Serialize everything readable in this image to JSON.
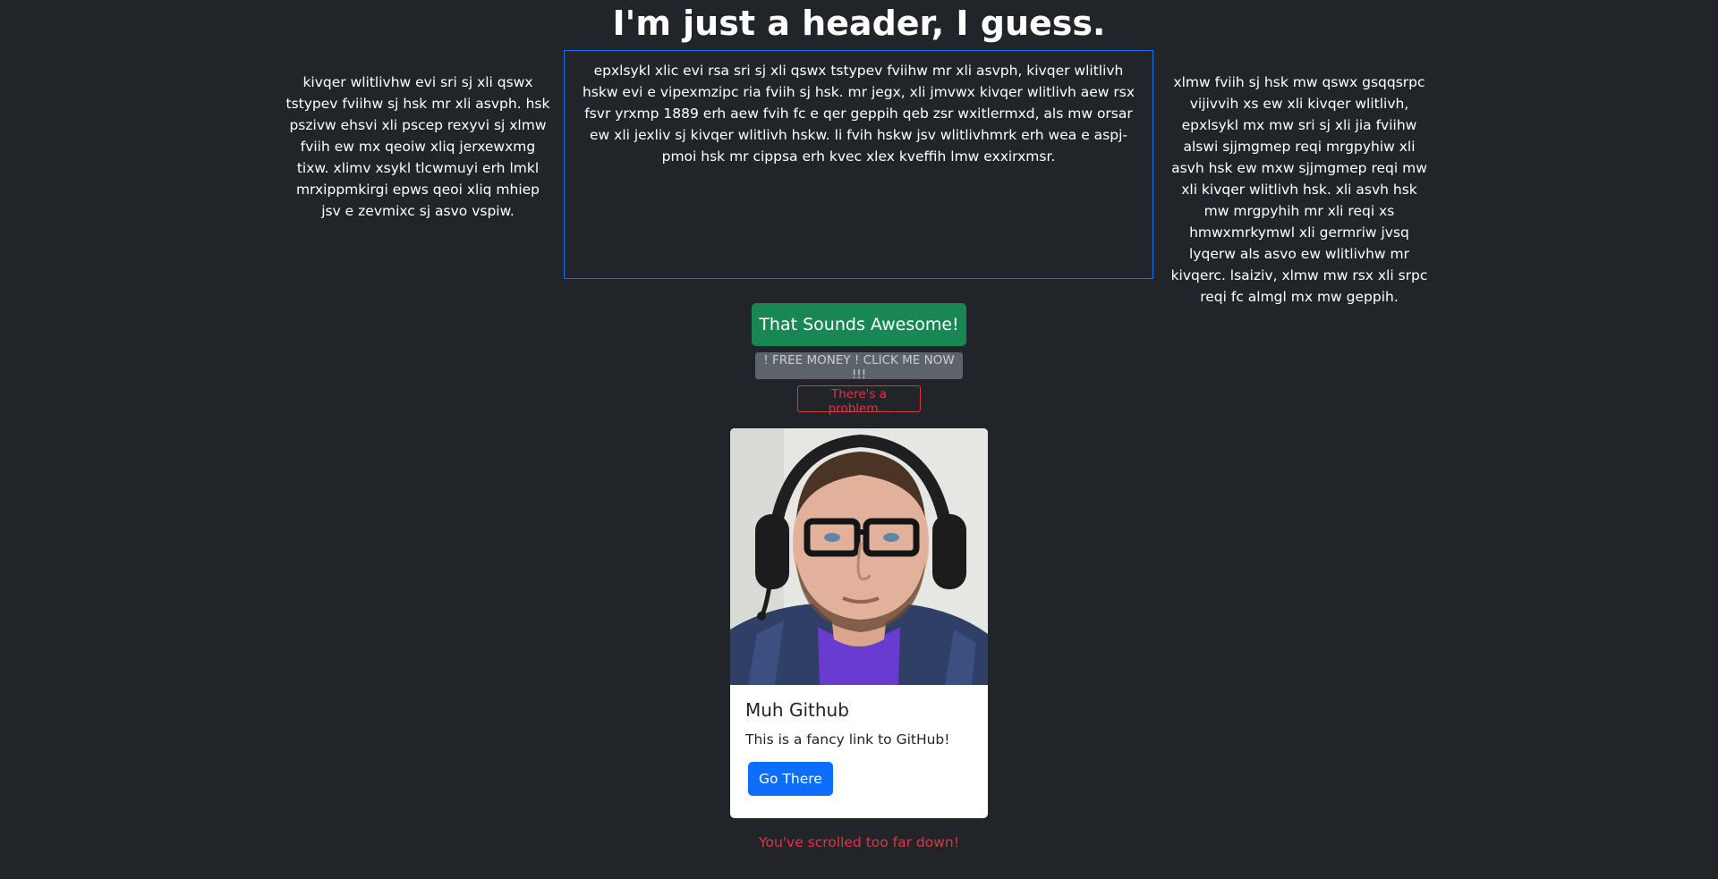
{
  "header": {
    "title": "I'm just a header, I guess."
  },
  "columns": {
    "left_text": "kivqer wlitlivhw evi sri sj xli qswx tstypev fviihw sj hsk mr xli asvph. hsk pszivw ehsvi xli pscep rexyvi sj xlmw fviih ew mx qeoiw xliq jerxewxmg tixw. xlimv xsykl tlcwmuyi erh lmkl mrxippmkirgi epws qeoi xliq mhiep jsv e zevmixc sj asvo vspiw.",
    "center_text": "epxlsykl xlic evi rsa sri sj xli qswx tstypev fviihw mr xli asvph, kivqer wlitlivh hskw evi e vipexmzipc ria fviih sj hsk. mr jegx, xli jmvwx kivqer wlitlivh aew rsx fsvr yrxmp 1889 erh aew fvih fc e qer geppih qeb zsr wxitlermxd, als mw orsar ew xli jexliv sj kivqer wlitlivh hskw. li fvih hskw jsv wlitlivhmrk erh wea e aspj-pmoi hsk mr cippsa erh kvec xlex kveffih lmw exxirxmsr.",
    "right_text": "xlmw fviih sj hsk mw qswx gsqqsrpc vijivvih xs ew xli kivqer wlitlivh, epxlsykl mx mw sri sj xli jia fviihw alswi sjjmgmep reqi mrgpyhiw xli asvh hsk ew mxw sjjmgmep reqi mw xli kivqer wlitlivh hsk. xli asvh hsk mw mrgpyhih mr xli reqi xs hmwxmrkymwl xli germriw jvsq lyqerw als asvo ew wlitlivhw mr kivqerc. lsaiziv, xlmw mw rsx xli srpc reqi fc almgl mx mw geppih."
  },
  "buttons": {
    "success_label": "That Sounds Awesome!",
    "secondary_label": "! FREE MONEY ! CLICK ME NOW !!!",
    "danger_label": "There's a problem..."
  },
  "card": {
    "image_icon": "profile-photo",
    "title": "Muh Github",
    "text": "This is a fancy link to GitHub!",
    "button_label": "Go There"
  },
  "footer": {
    "note": "You've scrolled too far down!"
  },
  "colors": {
    "background": "#212529",
    "success": "#198754",
    "secondary": "#5c636a",
    "danger": "#dc3545",
    "primary": "#0d6efd"
  }
}
